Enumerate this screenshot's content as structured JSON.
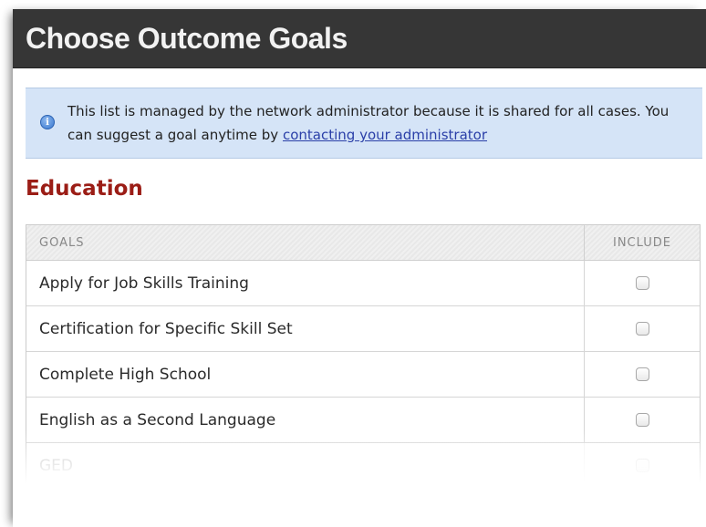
{
  "window": {
    "title": "Choose Outcome Goals"
  },
  "notice": {
    "icon": "info-icon",
    "text": "This list is managed by the network administrator because it is shared for all cases. You can suggest a goal anytime by ",
    "link_text": "contacting your administrator",
    "background_color": "#d5e4f7"
  },
  "section": {
    "heading": "Education",
    "heading_color": "#9b1d16"
  },
  "table": {
    "columns": {
      "goals": "GOALS",
      "include": "INCLUDE"
    },
    "rows": [
      {
        "goal": "Apply for Job Skills Training",
        "included": false
      },
      {
        "goal": "Certification for Specific Skill Set",
        "included": false
      },
      {
        "goal": "Complete High School",
        "included": false
      },
      {
        "goal": "English as a Second Language",
        "included": false
      },
      {
        "goal": "GED",
        "included": false
      }
    ]
  }
}
